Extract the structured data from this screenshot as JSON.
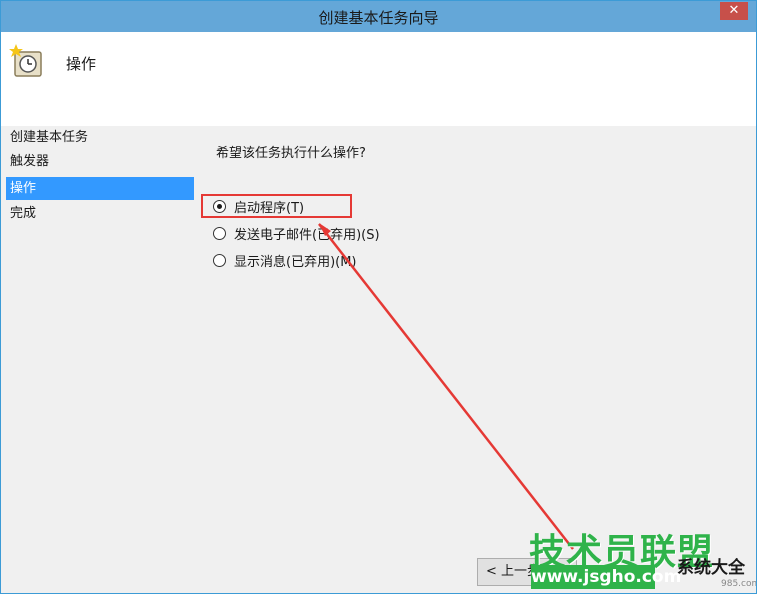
{
  "window": {
    "title": "创建基本任务向导",
    "close_symbol": "✕"
  },
  "header": {
    "title": "操作",
    "icon": "task-clock-icon"
  },
  "sidebar": {
    "items": [
      {
        "label": "创建基本任务",
        "active": false
      },
      {
        "label": "触发器",
        "active": false
      },
      {
        "label": "操作",
        "active": true
      },
      {
        "label": "完成",
        "active": false
      }
    ]
  },
  "content": {
    "question": "希望该任务执行什么操作?",
    "options": [
      {
        "label": "启动程序(T)",
        "checked": true
      },
      {
        "label": "发送电子邮件(已弃用)(S)",
        "checked": false
      },
      {
        "label": "显示消息(已弃用)(M)",
        "checked": false
      }
    ]
  },
  "footer": {
    "back_label": "< 上一步"
  },
  "watermark": {
    "main": "技术员联盟",
    "url": "www.jsgho.com",
    "side": "系统大全",
    "small": "985.com"
  },
  "colors": {
    "titlebar": "#64a7d8",
    "active_step": "#3399ff",
    "highlight": "#e53935",
    "watermark_green": "#2fb34a"
  }
}
